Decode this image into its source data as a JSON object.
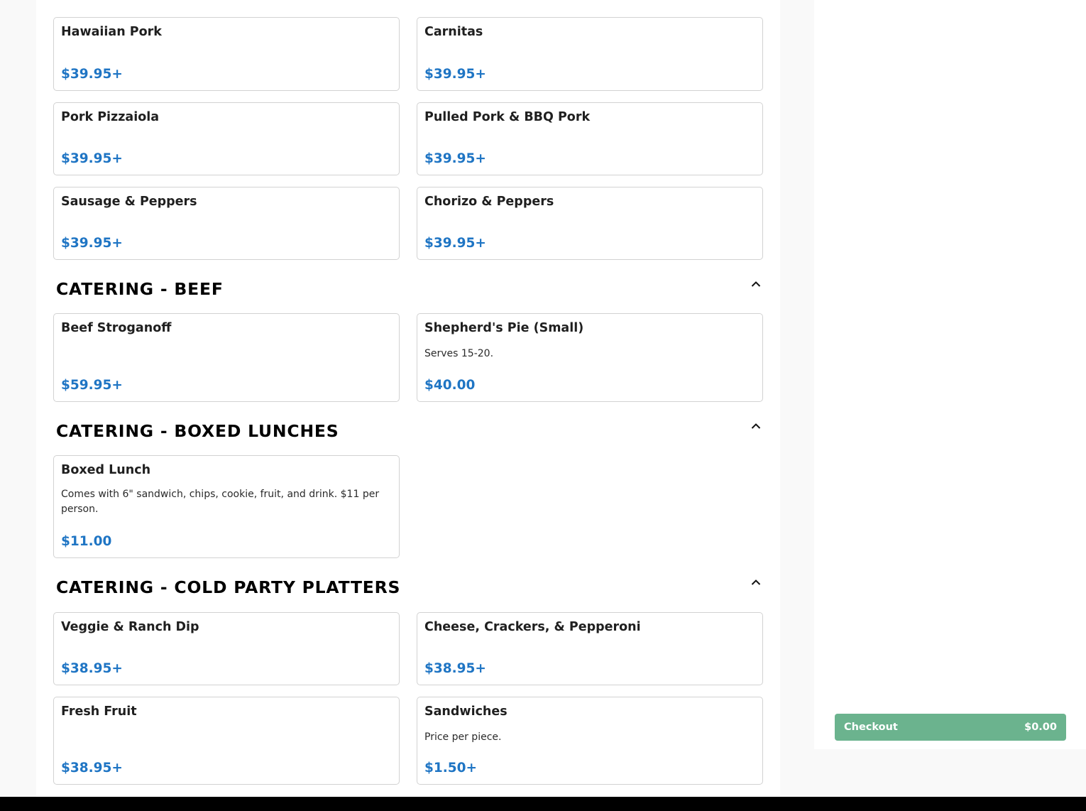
{
  "items": [
    {
      "name": "Hawaiian Pork",
      "price": "$39.95+"
    },
    {
      "name": "Carnitas",
      "price": "$39.95+"
    },
    {
      "name": "Pork Pizzaiola",
      "price": "$39.95+"
    },
    {
      "name": "Pulled Pork & BBQ Pork",
      "price": "$39.95+"
    },
    {
      "name": "Sausage & Peppers",
      "price": "$39.95+"
    },
    {
      "name": "Chorizo & Peppers",
      "price": "$39.95+"
    },
    {
      "name": "Beef Stroganoff",
      "price": "$59.95+"
    },
    {
      "name": "Shepherd's Pie (Small)",
      "description": "Serves 15-20.",
      "price": "$40.00"
    },
    {
      "name": "Boxed Lunch",
      "description": "Comes with 6\" sandwich, chips, cookie, fruit, and drink. $11 per person.",
      "price": "$11.00"
    },
    {
      "name": "Veggie & Ranch Dip",
      "price": "$38.95+"
    },
    {
      "name": "Cheese, Crackers, & Pepperoni",
      "price": "$38.95+"
    },
    {
      "name": "Fresh Fruit",
      "price": "$38.95+"
    },
    {
      "name": "Sandwiches",
      "description": "Price per piece.",
      "price": "$1.50+"
    }
  ],
  "sections": [
    {
      "title": "CATERING - BEEF"
    },
    {
      "title": "CATERING - BOXED LUNCHES"
    },
    {
      "title": "CATERING - COLD PARTY PLATTERS"
    }
  ],
  "icons": {
    "collapse": "chevron-up-icon"
  },
  "colors": {
    "price": "#1f75c4",
    "checkout": "#6bb38e"
  },
  "cart": {
    "checkout_label": "Checkout",
    "total": "$0.00"
  }
}
